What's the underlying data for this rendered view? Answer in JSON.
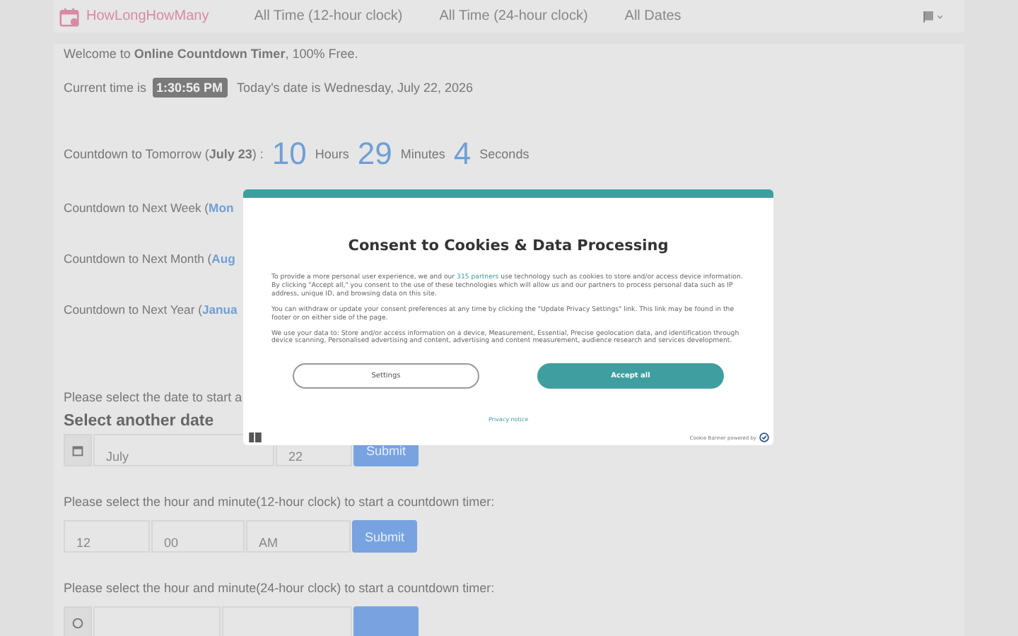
{
  "nav": {
    "brand": "HowLongHowMany",
    "links": [
      "All Time (12-hour clock)",
      "All Time (24-hour clock)",
      "All Dates"
    ]
  },
  "welcome": "Welcome to **Online Countdown Timer**, 100% Free.",
  "current": {
    "label": "Current time is",
    "time": "1:30:56 PM",
    "date_text": "Today's date is Wednesday, July 22, 2026"
  },
  "countdowns": [
    {
      "kind": "full",
      "label": "Countdown to Tomorrow (**July 23**) :",
      "units": [
        {
          "value": "10",
          "unit": "Hours"
        },
        {
          "value": "29",
          "unit": "Minutes"
        },
        {
          "value": "4",
          "unit": "Seconds"
        }
      ]
    },
    {
      "kind": "covered",
      "label": "Countdown to Next Week (",
      "highlight": "Mon"
    },
    {
      "kind": "covered",
      "label": "Countdown to Next Month (",
      "highlight": "Aug"
    },
    {
      "kind": "covered",
      "label": "Countdown to Next Year (",
      "highlight": "Janua"
    }
  ],
  "date_form": {
    "intro": "Please select the date to start a",
    "heading": "Select another date",
    "fields": [
      "July",
      "22"
    ],
    "button": "Submit"
  },
  "time12_form": {
    "intro": "Please select the hour and minute(12-hour clock) to start a countdown timer:",
    "fields": [
      "12",
      "00",
      "AM"
    ],
    "button": "Submit"
  },
  "time24_form": {
    "intro": "Please select the hour and minute(24-hour clock) to start a countdown timer:"
  },
  "consent": {
    "title": "Consent to Cookies & Data Processing",
    "p1_before": "To provide a more personal user experience, we and our",
    "p1_link": "315 partners",
    "p1_after": "use technology such as cookies to store and/or access device information. By clicking \"Accept all,\" you consent to the use of these technologies which will allow us and our partners to process personal data such as IP address, unique ID, and browsing data on this site.",
    "p2": "You can withdraw or update your consent preferences at any time by clicking the \"Update Privacy Settings\" link. This link may be found in the footer or on either side of the page.",
    "p3": "We use your data to: Store and/or access information on a device, Measurement, Essential, Precise geolocation data, and identification through device scanning, Personalised advertising and content, advertising and content measurement, audience research and services development.",
    "buttons": [
      "Settings",
      "Accept all"
    ],
    "privacy": "Privacy notice",
    "powered": "Cookie Banner powered by"
  }
}
